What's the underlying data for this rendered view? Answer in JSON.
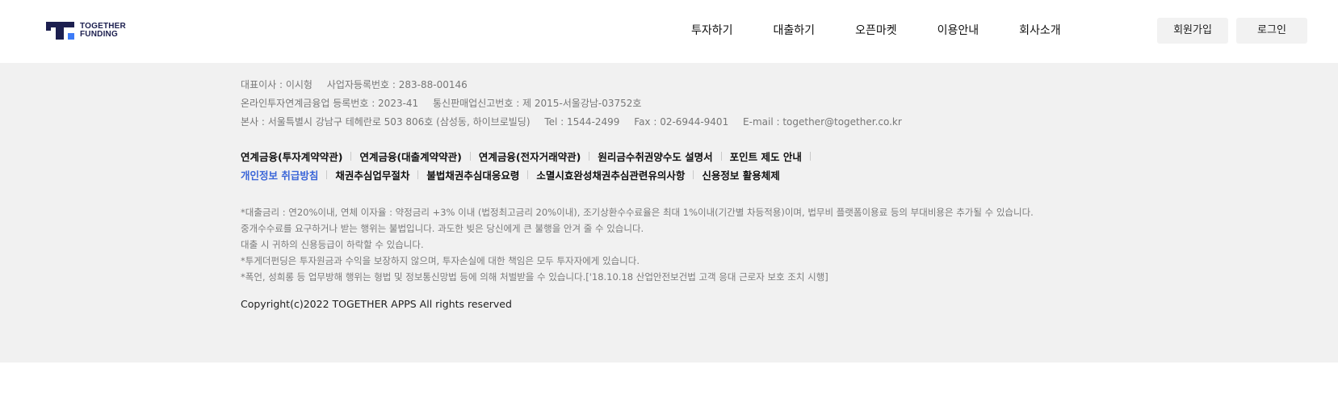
{
  "header": {
    "logo_text_line1": "TOGETHER",
    "logo_text_line2": "FUNDING",
    "nav": [
      "투자하기",
      "대출하기",
      "오픈마켓",
      "이용안내",
      "회사소개"
    ],
    "signup_label": "회원가입",
    "login_label": "로그인"
  },
  "footer": {
    "info": {
      "ceo": "대표이사 : 이시헝",
      "biz_reg": "사업자등록번호 : 283-88-00146",
      "p2p_reg": "온라인투자연계금융업 등록번호 : 2023-41",
      "ecommerce_reg": "통신판매업신고번호 : 제 2015-서울강남-03752호",
      "address": "본사 : 서울특별시 강남구 테헤란로 503 806호 (삼성동, 하이브로빌딩)",
      "tel": "Tel : 1544-2499",
      "fax": "Fax : 02-6944-9401",
      "email": "E-mail : together@together.co.kr"
    },
    "links_row1": [
      "연계금융(투자계약약관)",
      "연계금융(대출계약약관)",
      "연계금융(전자거래약관)",
      "원리금수취권양수도 설명서",
      "포인트 제도 안내"
    ],
    "links_row2": [
      "개인정보 취급방침",
      "채권추심업무절차",
      "불법채권추심대응요령",
      "소멸시효완성채권추심관련유의사항",
      "신용정보 활용체제"
    ],
    "notices": [
      "*대출금리 : 연20%이내, 연체 이자율 : 약정금리 +3% 이내 (법정최고금리 20%이내), 조기상환수수료율은 최대 1%이내(기간별 차등적용)이며, 법무비 플랫폼이용료 등의 부대비용은 추가될 수 있습니다.",
      "중개수수료를 요구하거나 받는 행위는 불법입니다. 과도한 빚은 당신에게 큰 불행을 안겨 줄 수 있습니다.",
      "대출 시 귀하의 신용등급이 하락할 수 있습니다.",
      "*투게더펀딩은 투자원금과 수익을 보장하지 않으며, 투자손실에 대한 책임은 모두 투자자에게 있습니다.",
      "*폭언, 성희롱 등 업무방해 행위는 형법 및 정보통신망법 등에 의해 처벌받을 수 있습니다.['18.10.18 산업안전보건법 고객 응대 근로자 보호 조치 시행]"
    ],
    "copyright": "Copyright(c)2022 TOGETHER APPS All rights reserved"
  },
  "colors": {
    "brand_navy": "#1c1f4f",
    "brand_blue": "#3d7bf7",
    "link_highlight": "#3b66d8",
    "footer_bg": "#f1f1f1"
  }
}
